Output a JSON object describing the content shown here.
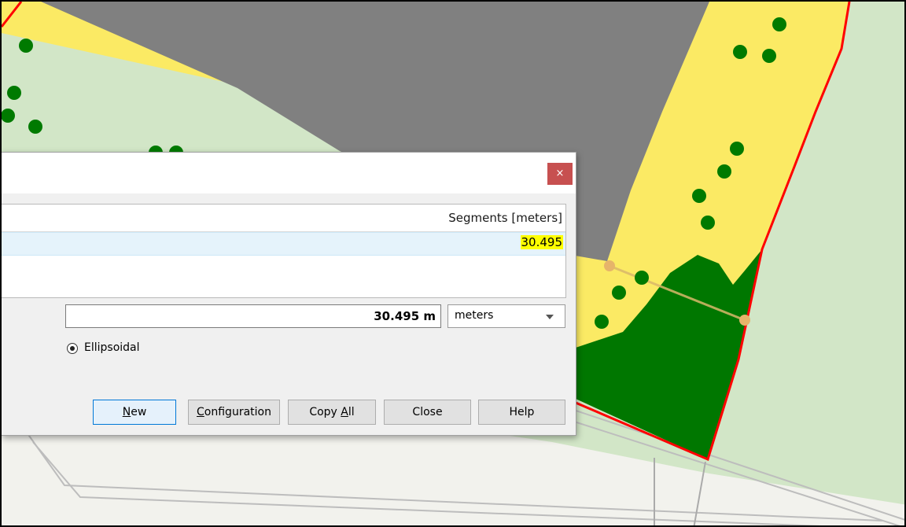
{
  "dialog": {
    "close_glyph": "×",
    "table": {
      "header_segments": "Segments [meters]",
      "rows": [
        {
          "segment": "30.495"
        }
      ]
    },
    "total": {
      "value": "30.495 m",
      "unit": "meters"
    },
    "ellipsoidal_label": "Ellipsoidal",
    "buttons": {
      "new": {
        "mnemonic": "N",
        "rest": "ew"
      },
      "configuration": {
        "mnemonic": "C",
        "rest": "onfiguration"
      },
      "copy_all": {
        "before": "Copy ",
        "mnemonic": "A",
        "after": "ll"
      },
      "close": "Close",
      "help": "Help"
    }
  },
  "colors": {
    "map_background": "#d2e6c7",
    "dark_area": "#808080",
    "yellow_area": "#fbea64",
    "green_area": "#007700",
    "tree": "#007a00",
    "boundary": "#ff0000",
    "highlight": "#ffff00"
  }
}
